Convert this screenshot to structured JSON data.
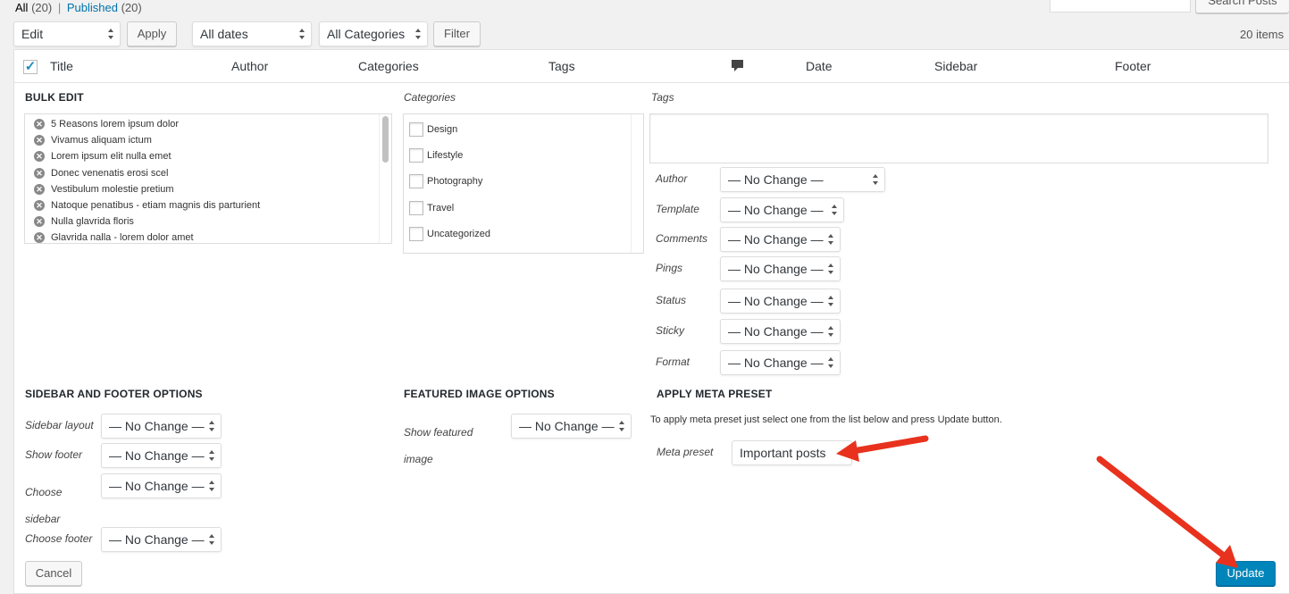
{
  "views": {
    "all": "All",
    "all_count": "(20)",
    "sep": "|",
    "published": "Published",
    "published_count": "(20)"
  },
  "search_button": "Search Posts",
  "toolbar": {
    "bulk_action": "Edit",
    "apply": "Apply",
    "dates": "All dates",
    "categories": "All Categories",
    "filter": "Filter",
    "items": "20 items"
  },
  "columns": {
    "title": "Title",
    "author": "Author",
    "categories": "Categories",
    "tags": "Tags",
    "date": "Date",
    "sidebar": "Sidebar",
    "footer": "Footer"
  },
  "bulk": {
    "heading": "BULK EDIT",
    "posts": [
      "5 Reasons lorem ipsum dolor",
      "Vivamus aliquam ictum",
      "Lorem ipsum elit nulla emet",
      "Donec venenatis erosi scel",
      "Vestibulum molestie pretium",
      "Natoque penatibus - etiam magnis dis parturient",
      "Nulla glavrida floris",
      "Glavrida nalla - lorem dolor amet"
    ],
    "categories_label": "Categories",
    "categories": [
      "Design",
      "Lifestyle",
      "Photography",
      "Travel",
      "Uncategorized"
    ],
    "tags_label": "Tags",
    "fields": [
      {
        "label": "Author",
        "value": "— No Change —"
      },
      {
        "label": "Template",
        "value": "— No Change —"
      },
      {
        "label": "Comments",
        "value": "— No Change —"
      },
      {
        "label": "Pings",
        "value": "— No Change —"
      },
      {
        "label": "Status",
        "value": "— No Change —"
      },
      {
        "label": "Sticky",
        "value": "— No Change —"
      },
      {
        "label": "Format",
        "value": "— No Change —"
      }
    ]
  },
  "sidebar_footer": {
    "heading": "SIDEBAR AND FOOTER OPTIONS",
    "sidebar_layout": "Sidebar layout",
    "show_footer": "Show footer",
    "choose_sidebar_1": "Choose",
    "choose_sidebar_2": "sidebar",
    "choose_footer": "Choose footer",
    "value": "— No Change —"
  },
  "featured": {
    "heading": "FEATURED IMAGE OPTIONS",
    "label_1": "Show featured",
    "label_2": "image",
    "value": "— No Change —"
  },
  "meta": {
    "heading": "APPLY META PRESET",
    "description": "To apply meta preset just select one from the list below and press Update button.",
    "label": "Meta preset",
    "value": "Important posts"
  },
  "cancel": "Cancel",
  "update": "Update",
  "colors": {
    "accent": "#0073aa",
    "update_button": "#0085ba",
    "annotation_arrow": "#e8321e"
  }
}
